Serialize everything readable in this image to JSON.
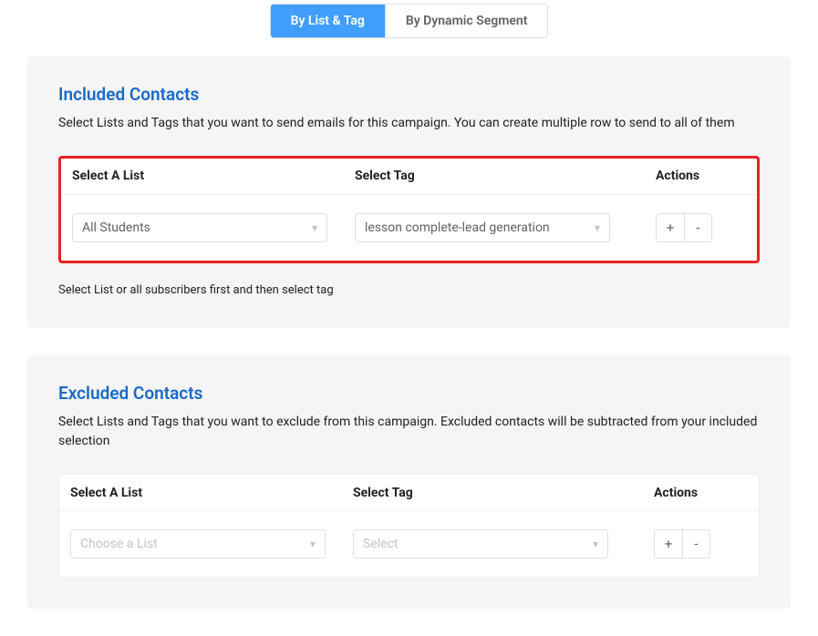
{
  "tabs": {
    "list_tag": "By List & Tag",
    "dynamic_segment": "By Dynamic Segment"
  },
  "included": {
    "title": "Included Contacts",
    "description": "Select Lists and Tags that you want to send emails for this campaign. You can create multiple row to send to all of them",
    "columns": {
      "list": "Select A List",
      "tag": "Select Tag",
      "actions": "Actions"
    },
    "row": {
      "list_value": "All Students",
      "tag_value": "lesson complete-lead generation"
    },
    "hint": "Select List or all subscribers first and then select tag"
  },
  "excluded": {
    "title": "Excluded Contacts",
    "description": "Select Lists and Tags that you want to exclude from this campaign. Excluded contacts will be subtracted from your included selection",
    "columns": {
      "list": "Select A List",
      "tag": "Select Tag",
      "actions": "Actions"
    },
    "row": {
      "list_placeholder": "Choose a List",
      "tag_placeholder": "Select"
    }
  },
  "actions": {
    "add": "+",
    "remove": "-"
  }
}
